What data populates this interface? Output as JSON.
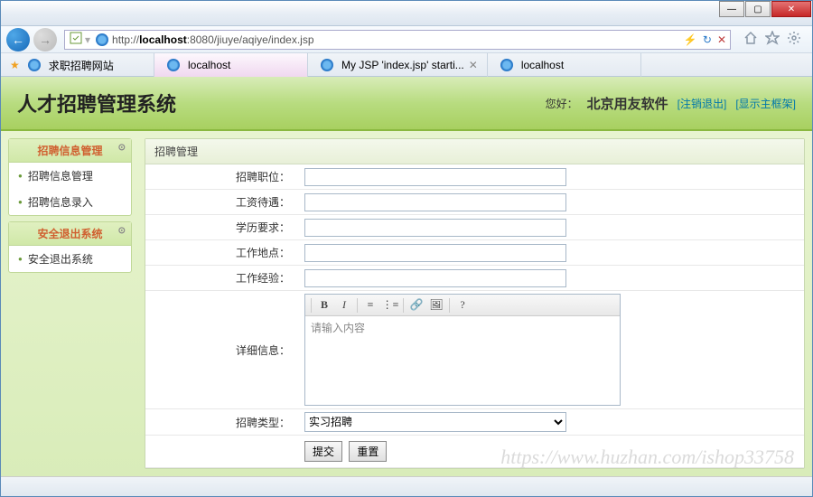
{
  "window": {
    "min": "—",
    "max": "▢",
    "close": "✕"
  },
  "url": {
    "prefix": "http://",
    "host": "localhost",
    "rest": ":8080/jiuye/aqiye/index.jsp"
  },
  "tabs": [
    {
      "label": "求职招聘网站",
      "active": false,
      "star": true
    },
    {
      "label": "localhost",
      "active": true,
      "star": false
    },
    {
      "label": "My JSP 'index.jsp' starti...",
      "active": false,
      "star": false,
      "closable": true
    },
    {
      "label": "localhost",
      "active": false,
      "star": false
    }
  ],
  "header": {
    "title": "人才招聘管理系统",
    "greet": "您好：",
    "user": "北京用友软件",
    "link1": "[注销退出]",
    "link2": "[显示主框架]"
  },
  "sidebar": {
    "box1": {
      "title": "招聘信息管理",
      "items": [
        "招聘信息管理",
        "招聘信息录入"
      ]
    },
    "box2": {
      "title": "安全退出系统",
      "items": [
        "安全退出系统"
      ]
    }
  },
  "main": {
    "title": "招聘管理",
    "fields": {
      "f1": "招聘职位：",
      "f2": "工资待遇：",
      "f3": "学历要求：",
      "f4": "工作地点：",
      "f5": "工作经验：",
      "f6": "详细信息：",
      "f7": "招聘类型："
    },
    "editor_placeholder": "请输入内容",
    "select_value": "实习招聘",
    "btn_submit": "提交",
    "btn_reset": "重置"
  },
  "watermark": "https://www.huzhan.com/ishop33758"
}
